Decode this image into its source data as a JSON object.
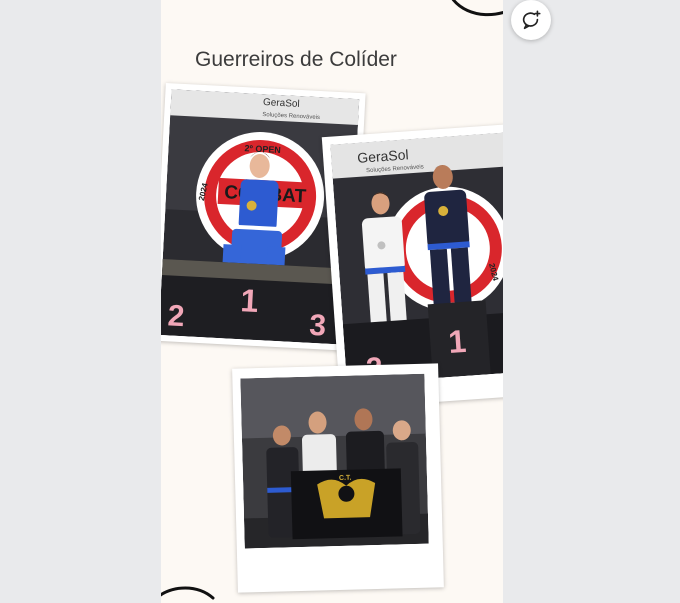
{
  "story": {
    "title": "Guerreiros de Colíder"
  },
  "photos": [
    {
      "banner_sponsor": "GeraSol",
      "banner_sponsor_sub": "Soluções Renováveis",
      "event_edition": "2º OPEN",
      "event_name": "COMBAT",
      "event_year": "2024",
      "podium_left": "2",
      "podium_center": "1",
      "podium_right": "3"
    },
    {
      "banner_sponsor": "GeraSol",
      "banner_sponsor_sub": "Soluções Renováveis",
      "event_year": "2024",
      "podium_left": "2",
      "podium_center": "1"
    },
    {
      "flag_text": "C.T."
    }
  ],
  "actions": {
    "comment_icon": "add-comment-icon"
  }
}
